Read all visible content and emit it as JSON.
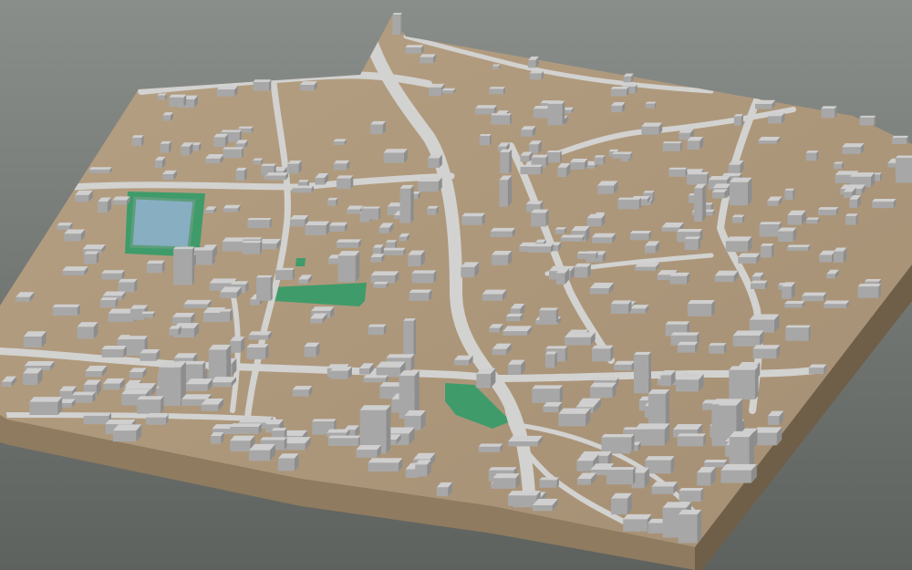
{
  "scene": {
    "background_top": "#8a8e8a",
    "background_bottom": "#5e625f",
    "terrain_top_color": "#a58f74",
    "terrain_top_light": "#b6a083",
    "terrain_side_color": "#8f7b5f",
    "terrain_side_dark": "#6f5e48",
    "road_color": "#d2d2d0",
    "road_edge": "#a9a6a1",
    "building_top": "#cfcfcf",
    "building_side": "#a7a7a7",
    "building_dark": "#8d8d8d",
    "park_color": "#3f9b6a",
    "park_light": "#59b27f",
    "water_color": "#88aec2",
    "water_edge": "#5e9e7c"
  }
}
